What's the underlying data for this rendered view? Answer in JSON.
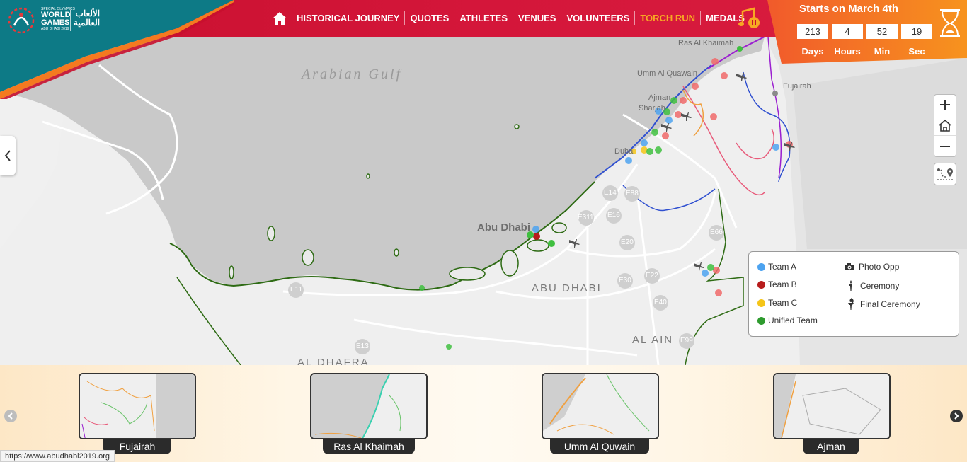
{
  "brand": {
    "line1": "SPECIAL OLYMPICS",
    "line2": "WORLD",
    "line3": "GAMES",
    "line4": "ABU DHABI 2019",
    "arabic1": "الألعاب",
    "arabic2": "العالمية"
  },
  "nav": {
    "items": [
      {
        "label": "HISTORICAL JOURNEY",
        "active": false
      },
      {
        "label": "QUOTES",
        "active": false
      },
      {
        "label": "ATHLETES",
        "active": false
      },
      {
        "label": "VENUES",
        "active": false
      },
      {
        "label": "VOLUNTEERS",
        "active": false
      },
      {
        "label": "TORCH RUN",
        "active": true
      },
      {
        "label": "MEDALS",
        "active": false
      }
    ]
  },
  "countdown": {
    "title": "Starts on March 4th",
    "values": [
      "213",
      "4",
      "52",
      "19"
    ],
    "labels": [
      "Days",
      "Hours",
      "Min",
      "Sec"
    ]
  },
  "map": {
    "sea_label": "Arabian Gulf",
    "partial_label": "ain",
    "cities": [
      "Ras Al Khaimah",
      "Umm Al Quawain",
      "Fujairah",
      "Ajman",
      "Sharjah",
      "Dubai",
      "Abu Dhabi"
    ],
    "regions": [
      "ABU DHABI",
      "AL AIN",
      "AL DHAFRA"
    ],
    "roads": [
      "E14",
      "E88",
      "E16",
      "E311",
      "E20",
      "E30",
      "E22",
      "E40",
      "E11",
      "E13",
      "E66",
      "E95",
      "E99"
    ]
  },
  "legend": {
    "items": [
      {
        "label": "Team A",
        "color": "#4da3f0"
      },
      {
        "label": "Team B",
        "color": "#b71c1c"
      },
      {
        "label": "Team C",
        "color": "#f5c518"
      },
      {
        "label": "Unified Team",
        "color": "#2e9b2e"
      }
    ],
    "icons": [
      {
        "label": "Photo Opp",
        "icon": "camera-icon"
      },
      {
        "label": "Ceremony",
        "icon": "torch-icon"
      },
      {
        "label": "Final Ceremony",
        "icon": "final-torch-icon"
      }
    ]
  },
  "thumbnails": [
    "Fujairah",
    "Ras Al Khaimah",
    "Umm Al Quwain",
    "Ajman"
  ],
  "status_url": "https://www.abudhabi2019.org",
  "colors": {
    "header_red": "#c8102e",
    "teal": "#0d7a86",
    "orange": "#f47a20",
    "active_nav": "#f7a823"
  }
}
